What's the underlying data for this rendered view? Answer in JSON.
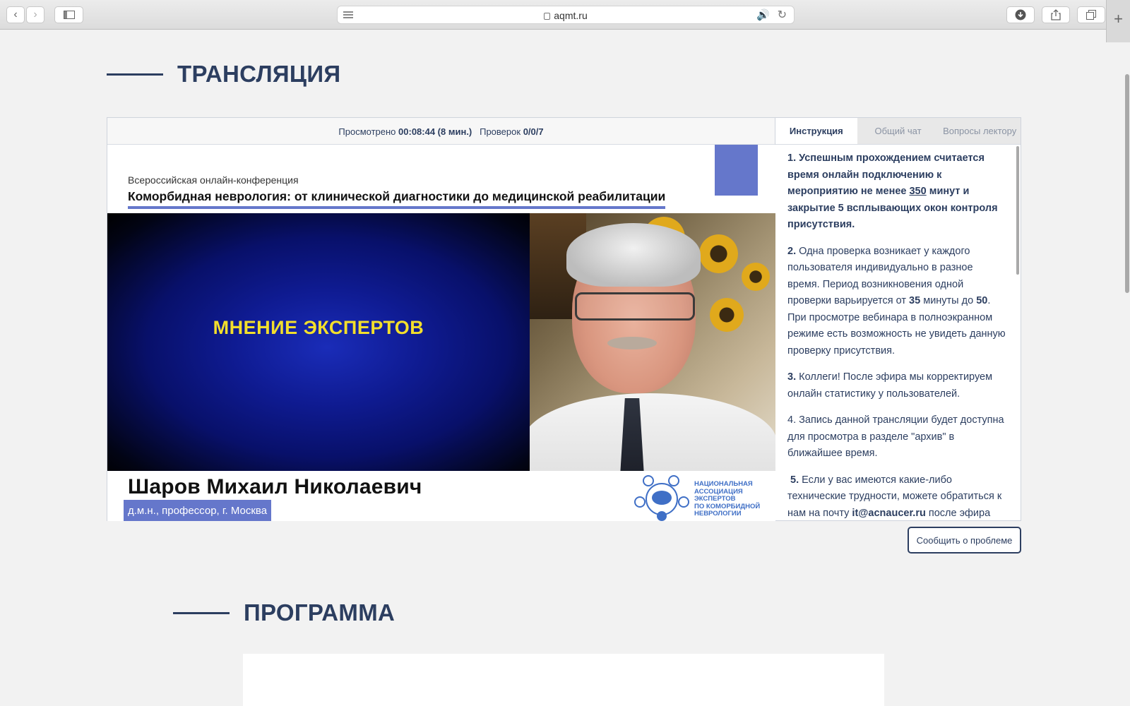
{
  "browser": {
    "url": "aqmt.ru",
    "back_icon": "‹",
    "forward_icon": "›",
    "newtab_icon": "+"
  },
  "section_broadcast": {
    "title": "ТРАНСЛЯЦИЯ"
  },
  "section_program": {
    "title": "ПРОГРАММА"
  },
  "player": {
    "watched_label": "Просмотрено",
    "watched_value": "00:08:44 (8 мин.)",
    "checks_label": "Проверок",
    "checks_value": "0/0/7"
  },
  "video": {
    "subtitle": "Всероссийская онлайн-конференция",
    "title": "Коморбидная неврология: от клинической диагностики до медицинской реабилитации",
    "slide_text": "МНЕНИЕ ЭКСПЕРТОВ",
    "speaker_name": "Шаров Михаил Николаевич",
    "speaker_role": "д.м.н., профессор, г. Москва",
    "logo_lines": [
      "НАЦИОНАЛЬНАЯ",
      "АССОЦИАЦИЯ",
      "ЭКСПЕРТОВ",
      "ПО КОМОРБИДНОЙ",
      "НЕВРОЛОГИИ"
    ]
  },
  "side": {
    "tabs": [
      {
        "label": "Инструкция",
        "active": true
      },
      {
        "label": "Общий чат",
        "active": false
      },
      {
        "label": "Вопросы лектору",
        "active": false
      }
    ],
    "instructions": {
      "p1_num": "1.",
      "p1_a": "Успешным прохождением считается время онлайн подключению к мероприятию не менее",
      "p1_minutes": "350",
      "p1_b": "минут и закрытие 5 всплывающих окон контроля присутствия.",
      "p2_num": "2.",
      "p2_a": "Одна проверка возникает у каждого пользователя индивидуально в разное время. Период возникновения одной проверки варьируется от",
      "p2_from": "35",
      "p2_b": "минуты до",
      "p2_to": "50",
      "p2_c": ". При просмотре вебинара в полноэкранном режиме есть возможность не увидеть данную проверку присутствия.",
      "p3_num": "3.",
      "p3_a": "Коллеги! После эфира мы корректируем онлайн статистику у пользователей.",
      "p4": "4. Запись данной трансляции будет доступна для просмотра в разделе \"архив\" в ближайшее время.",
      "p5_num": "5.",
      "p5_a": "Если у вас имеются какие-либо технические трудности, можете обратиться к нам на почту",
      "p5_email": "it@acnaucer.ru",
      "p5_b": "после эфира"
    }
  },
  "report_button": "Сообщить о проблеме",
  "colors": {
    "accent": "#2c3e60",
    "brand_blue": "#6577cb",
    "slide_text": "#f3df2c"
  }
}
